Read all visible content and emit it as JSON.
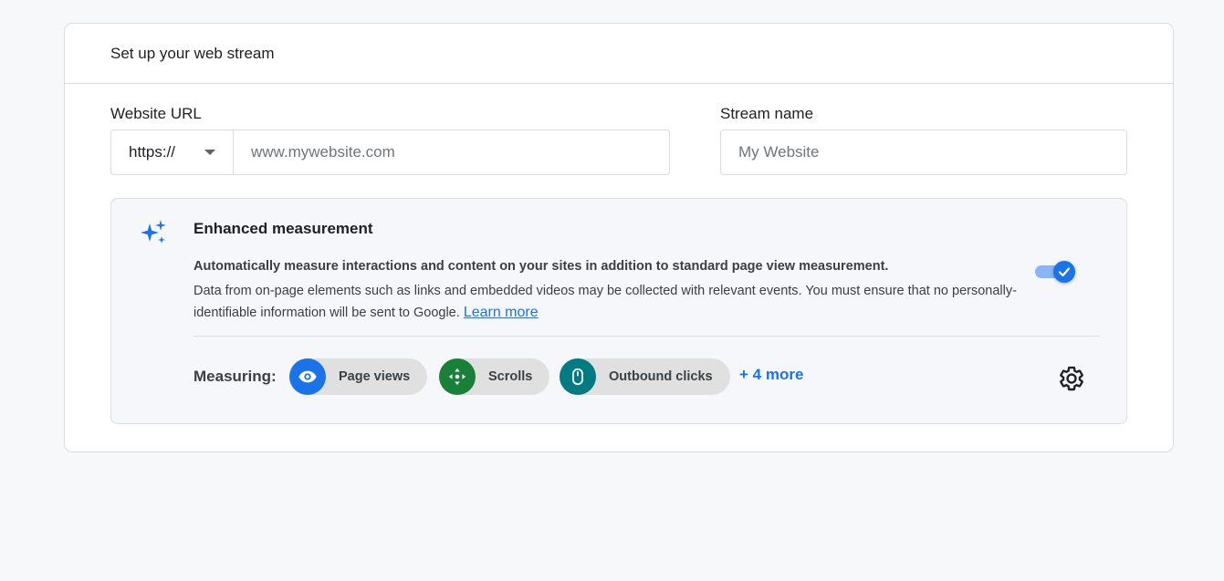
{
  "header": {
    "title": "Set up your web stream"
  },
  "website_url": {
    "label": "Website URL",
    "protocol": "https://",
    "placeholder": "www.mywebsite.com"
  },
  "stream_name": {
    "label": "Stream name",
    "placeholder": "My Website"
  },
  "enhanced": {
    "title": "Enhanced measurement",
    "summary": "Automatically measure interactions and content on your sites in addition to standard page view measurement.",
    "description": "Data from on-page elements such as links and embedded videos may be collected with relevant events. You must ensure that no personally-identifiable information will be sent to Google.",
    "learn_more": "Learn more",
    "toggle_on": true,
    "measuring_label": "Measuring:",
    "chips": [
      {
        "label": "Page views",
        "icon": "eye-icon",
        "color": "#1a73e8"
      },
      {
        "label": "Scrolls",
        "icon": "scroll-arrows-icon",
        "color": "#188038"
      },
      {
        "label": "Outbound clicks",
        "icon": "mouse-icon",
        "color": "#007b83"
      }
    ],
    "more": "+ 4 more",
    "settings_icon": "gear-icon"
  },
  "colors": {
    "accent": "#1a73e8",
    "background": "#f7f8fa",
    "border": "#dadce0"
  }
}
